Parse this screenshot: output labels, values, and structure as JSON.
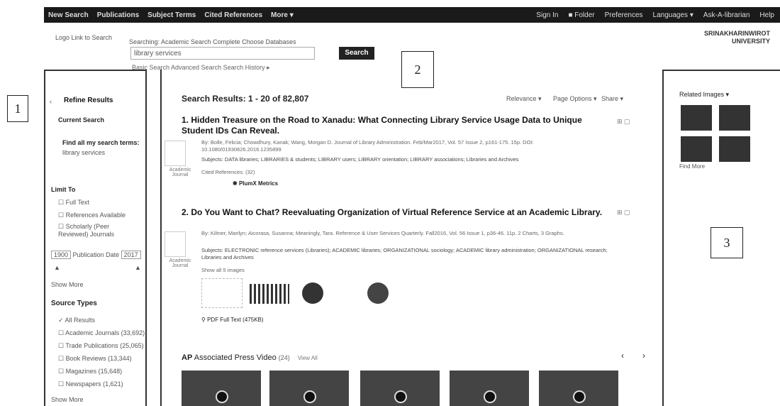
{
  "topbar": {
    "new_search": "New Search",
    "publications": "Publications",
    "subject_terms": "Subject Terms",
    "cited_references": "Cited References",
    "more": "More ▾",
    "sign_in": "Sign In",
    "folder": "Folder",
    "preferences": "Preferences",
    "languages": "Languages ▾",
    "ask_librarian": "Ask-A-librarian",
    "help": "Help"
  },
  "search": {
    "logo_text": "Logo  Link to Search",
    "searching_label": "Searching: Academic Search Complete   Choose Databases",
    "query": "library services",
    "search_label": "Search",
    "basic_links": "Basic Search   Advanced Search   Search History ▸",
    "university": "SRINAKHARINWIROT\nUNIVERSITY"
  },
  "left": {
    "refine": "Refine Results",
    "current_search": "Current Search",
    "find_all": "Find all my search terms:",
    "terms": "library services",
    "limit_to": "Limit To",
    "full_text": "Full Text",
    "refs_available": "References Available",
    "scholarly": "Scholarly (Peer Reviewed) Journals",
    "year_from": "1900",
    "pub_date": "Publication Date",
    "year_to": "2017",
    "show_more": "Show More",
    "source_types": "Source Types",
    "all_results": "All Results",
    "acad": "Academic Journals (33,692)",
    "trade": "Trade Publications (25,065)",
    "book": "Book Reviews (13,344)",
    "mag": "Magazines (15,648)",
    "news": "Newspapers (1,621)",
    "show_more2": "Show More"
  },
  "main": {
    "results": "Search Results: 1 - 20 of 82,807",
    "relevance": "Relevance ▾",
    "page_options": "Page Options ▾",
    "share": "Share ▾",
    "r1_title": "1. Hidden Treasure on the Road to Xanadu: What Connecting Library Service Usage Data to Unique Student IDs Can Reveal.",
    "r1_by": "By: Bolle, Felicia; Chowdhury, Kanak; Wang, Morgan D. Journal of Library Administration. Feb/Mar2017, Vol. 57 Issue 2, p161-175. 15p. DOI: 10.1080/01930826.2016.1235899",
    "r1_subj": "Subjects: DATA libraries; LIBRARIES & students; LIBRARY users; LIBRARY orientation; LIBRARY associations; Libraries and Archives",
    "r1_cited": "Cited References: (32)",
    "r1_plumx": "PlumX Metrics",
    "r2_title": "2. Do You Want to Chat? Reevaluating Organization of Virtual Reference Service at an Academic Library.",
    "r2_by": "By: Kiltner, Marilyn; Aicorasa, Susanna; Meaningly, Tara. Reference & User Services Quarterly. Fall2016, Vol. 56 Issue 1, p36-46. 11p. 2 Charts, 3 Graphs.",
    "r2_subj": "Subjects: ELECTRONIC reference services (Libraries); ACADEMIC libraries; ORGANIZATIONAL sociology; ACADEMIC library administration; ORGANIZATIONAL research; Libraries and Archives",
    "r2_show": "Show all 5 images",
    "r2_pdf": "PDF Full Text (475KB)",
    "doc_type": "Academic Journal",
    "ap_label": "AP",
    "ap_title": "Associated Press Video",
    "ap_count": "(24)",
    "view_all": "View All"
  },
  "right": {
    "related": "Related Images ▾",
    "find_more": "Find More"
  },
  "labels": {
    "n1": "1",
    "n2": "2",
    "n3": "3"
  }
}
